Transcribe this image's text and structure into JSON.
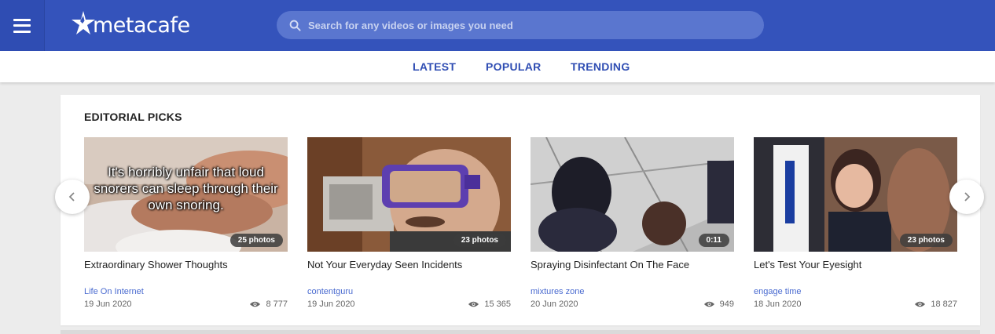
{
  "header": {
    "logo_text": "metacafe",
    "search_placeholder": "Search for any videos or images you need",
    "brand_color": "#3453bb"
  },
  "subnav": {
    "tabs": [
      "LATEST",
      "POPULAR",
      "TRENDING"
    ]
  },
  "editorial": {
    "title": "EDITORIAL PICKS",
    "items": [
      {
        "title": "Extraordinary Shower Thoughts",
        "channel": "Life On Internet",
        "date": "19 Jun 2020",
        "views": "8 777",
        "badge": "25 photos",
        "overlay": "It's horribly unfair that loud snorers can sleep through their own snoring."
      },
      {
        "title": "Not Your Everyday Seen Incidents",
        "channel": "contentguru",
        "date": "19 Jun 2020",
        "views": "15 365",
        "badge": "23 photos"
      },
      {
        "title": "Spraying Disinfectant On The Face",
        "channel": "mixtures zone",
        "date": "20 Jun 2020",
        "views": "949",
        "badge": "0:11"
      },
      {
        "title": "Let's Test Your Eyesight",
        "channel": "engage time",
        "date": "18 Jun 2020",
        "views": "18 827",
        "badge": "23 photos"
      }
    ]
  },
  "icons": {
    "menu": "hamburger-icon",
    "search": "search-icon",
    "views": "eye-icon",
    "prev": "chevron-left-icon",
    "next": "chevron-right-icon"
  }
}
